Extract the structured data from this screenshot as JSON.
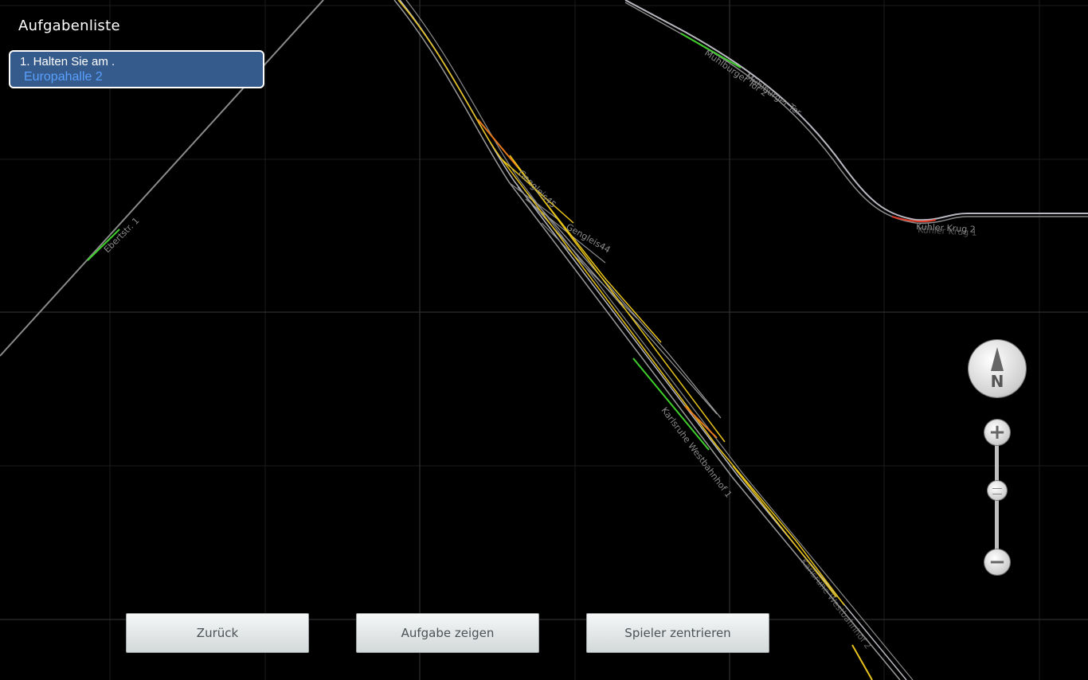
{
  "task_panel": {
    "title": "Aufgabenliste",
    "tasks": [
      {
        "text": "1. Halten Sie am .",
        "target": "Europahalle 2"
      }
    ]
  },
  "map": {
    "labels": [
      {
        "name": "label-ebertstr",
        "text": "Ebertstr. 1"
      },
      {
        "name": "label-muehlburger-tor-2",
        "text": "Mühlburger Tor 2"
      },
      {
        "name": "label-muehlburger-tor",
        "text": "Mühlburger Tor"
      },
      {
        "name": "label-kuehler-krug",
        "text": "Kühler Krug 2"
      },
      {
        "name": "label-kuehler-krug-1",
        "text": "Kühler Krug 1"
      },
      {
        "name": "label-gengleis45",
        "text": "Gengleis45"
      },
      {
        "name": "label-gengleis44",
        "text": "Gengleis44"
      },
      {
        "name": "label-westbahnhof",
        "text": "Karlsruhe Westbahnhof 1"
      },
      {
        "name": "label-westbahnhof-2",
        "text": "Karlsruhe Westbahnhof 2"
      }
    ],
    "colors": {
      "grid": "#2a2a2a",
      "track": "#9a9a9a",
      "track_main": "#b8b8c0",
      "active_green": "#3ecf2a",
      "active_yellow": "#e8c31a",
      "active_orange": "#e87a1a",
      "active_red": "#e03a2a"
    }
  },
  "controls": {
    "compass_letter": "N",
    "zoom_in_symbol": "+",
    "zoom_out_symbol": "−"
  },
  "buttons": {
    "back": "Zurück",
    "show_task": "Aufgabe zeigen",
    "center_player": "Spieler zentrieren"
  }
}
